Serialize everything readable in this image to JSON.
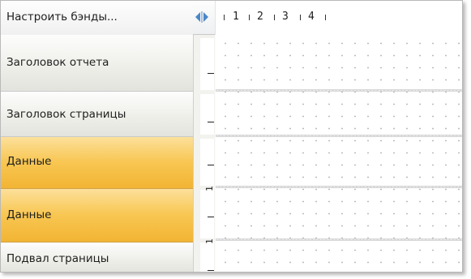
{
  "toolbar": {
    "configure_bands_label": "Настроить бэнды..."
  },
  "ruler": {
    "numbers": [
      "1",
      "2",
      "3",
      "4"
    ],
    "vertical_number": "1"
  },
  "bands": [
    {
      "label": "Заголовок отчета",
      "type": "normal"
    },
    {
      "label": "Заголовок страницы",
      "type": "normal"
    },
    {
      "label": "Данные",
      "type": "data",
      "selected": true
    },
    {
      "label": "Данные",
      "type": "data",
      "selected": true
    },
    {
      "label": "Подвал страницы",
      "type": "normal"
    }
  ],
  "colors": {
    "data_band": "#f8c651",
    "splitter_arrows": "#4a87c8",
    "normal_band": "#efefea"
  },
  "icons": {
    "splitter": "left-right-arrows-icon"
  }
}
